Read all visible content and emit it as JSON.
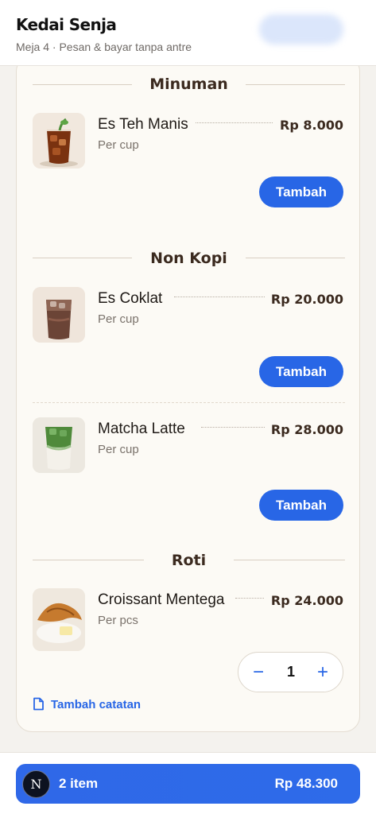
{
  "header": {
    "title": "Kedai Senja",
    "subtitle": "Meja 4 · Pesan & bayar tanpa antre"
  },
  "sections": [
    {
      "title": "Minuman",
      "items": [
        {
          "name": "Es Teh Manis",
          "unit": "Per cup",
          "price": "Rp 8.000",
          "action": "Tambah"
        }
      ]
    },
    {
      "title": "Non Kopi",
      "items": [
        {
          "name": "Es Coklat",
          "unit": "Per cup",
          "price": "Rp 20.000",
          "action": "Tambah"
        },
        {
          "name": "Matcha Latte",
          "unit": "Per cup",
          "price": "Rp 28.000",
          "action": "Tambah"
        }
      ]
    },
    {
      "title": "Roti",
      "items": [
        {
          "name": "Croissant Mentega",
          "unit": "Per pcs",
          "price": "Rp 24.000",
          "quantity": "1",
          "decrement": "−",
          "increment": "+"
        }
      ]
    }
  ],
  "note_link": "Tambah catatan",
  "cart": {
    "avatar": "N",
    "count": "2 item",
    "total": "Rp 48.300"
  },
  "colors": {
    "accent": "#2866e6",
    "background": "#f4f2ee",
    "card": "#fcfaf5",
    "heading": "#3b2a1f"
  },
  "icons": {
    "note": "document-icon"
  }
}
